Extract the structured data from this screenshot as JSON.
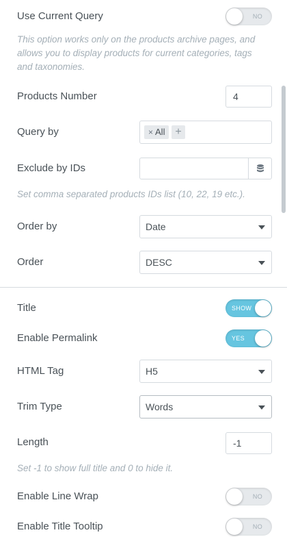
{
  "query": {
    "use_current_query": {
      "label": "Use Current Query",
      "toggle_text": "NO",
      "state": "off"
    },
    "use_current_query_desc": "This option works only on the products archive pages, and allows you to display products for current categories, tags and taxonomies.",
    "products_number": {
      "label": "Products Number",
      "value": "4"
    },
    "query_by": {
      "label": "Query by",
      "tag": "All",
      "tag_remove": "×",
      "add": "+"
    },
    "exclude_by_ids": {
      "label": "Exclude by IDs",
      "value": "",
      "icon": "database-icon"
    },
    "exclude_desc": "Set comma separated products IDs list (10, 22, 19 etc.).",
    "order_by": {
      "label": "Order by",
      "value": "Date"
    },
    "order": {
      "label": "Order",
      "value": "DESC"
    }
  },
  "title_section": {
    "title": {
      "label": "Title",
      "toggle_text": "SHOW",
      "state": "on"
    },
    "enable_permalink": {
      "label": "Enable Permalink",
      "toggle_text": "YES",
      "state": "on"
    },
    "html_tag": {
      "label": "HTML Tag",
      "value": "H5"
    },
    "trim_type": {
      "label": "Trim Type",
      "value": "Words"
    },
    "length": {
      "label": "Length",
      "value": "-1"
    },
    "length_desc": "Set -1 to show full title and 0 to hide it.",
    "enable_line_wrap": {
      "label": "Enable Line Wrap",
      "toggle_text": "NO",
      "state": "off"
    },
    "enable_title_tooltip": {
      "label": "Enable Title Tooltip",
      "toggle_text": "NO",
      "state": "off"
    }
  },
  "colors": {
    "toggle_on": "#66c5e0",
    "toggle_off": "#e6e9ec",
    "text": "#495157",
    "muted": "#a4afb7",
    "border": "#d5dadf"
  }
}
